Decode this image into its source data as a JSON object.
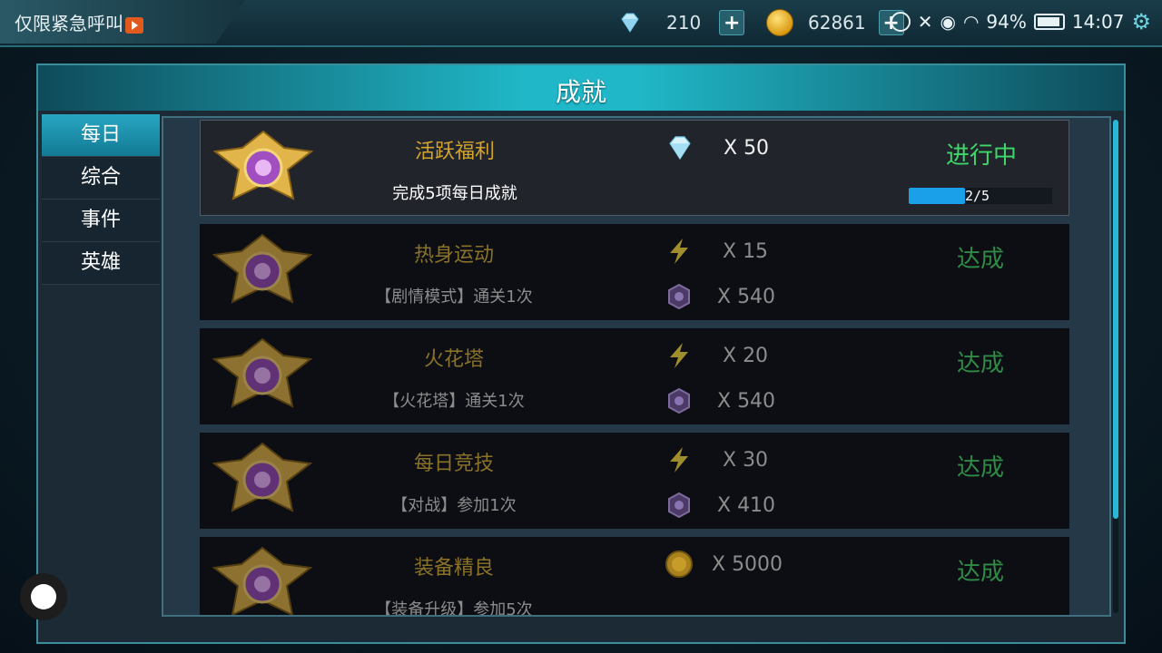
{
  "topbar": {
    "emergency_label": "仅限紧急呼叫",
    "gems": "210",
    "gold": "62861",
    "battery": "94%",
    "time": "14:07"
  },
  "panel": {
    "title": "成就",
    "tabs": [
      "每日",
      "综合",
      "事件",
      "英雄"
    ],
    "active_tab": "每日"
  },
  "achievements": [
    {
      "name": "活跃福利",
      "desc": "完成5项每日成就",
      "rewards": [
        {
          "icon": "diamond-icon",
          "amount": "X 50"
        }
      ],
      "status": "进行中",
      "progress": "2/5",
      "progress_value": 0.4
    },
    {
      "name": "热身运动",
      "desc": "【剧情模式】通关1次",
      "rewards": [
        {
          "icon": "lightning-icon",
          "amount": "X 15"
        },
        {
          "icon": "purple-token-icon",
          "amount": "X 540"
        }
      ],
      "status": "达成"
    },
    {
      "name": "火花塔",
      "desc": "【火花塔】通关1次",
      "rewards": [
        {
          "icon": "lightning-icon",
          "amount": "X 20"
        },
        {
          "icon": "purple-token-icon",
          "amount": "X 540"
        }
      ],
      "status": "达成"
    },
    {
      "name": "每日竞技",
      "desc": "【对战】参加1次",
      "rewards": [
        {
          "icon": "lightning-icon",
          "amount": "X 30"
        },
        {
          "icon": "purple-token-icon",
          "amount": "X 410"
        }
      ],
      "status": "达成"
    },
    {
      "name": "装备精良",
      "desc": "【装备升级】参加5次",
      "rewards": [
        {
          "icon": "gold-coin-icon",
          "amount": "X 5000"
        }
      ],
      "status": "达成"
    }
  ],
  "colors": {
    "accent": "#20b8c8",
    "progress_text": "#3ed86a",
    "done_text": "#2f8a46",
    "title_gold": "#d4a52a"
  }
}
